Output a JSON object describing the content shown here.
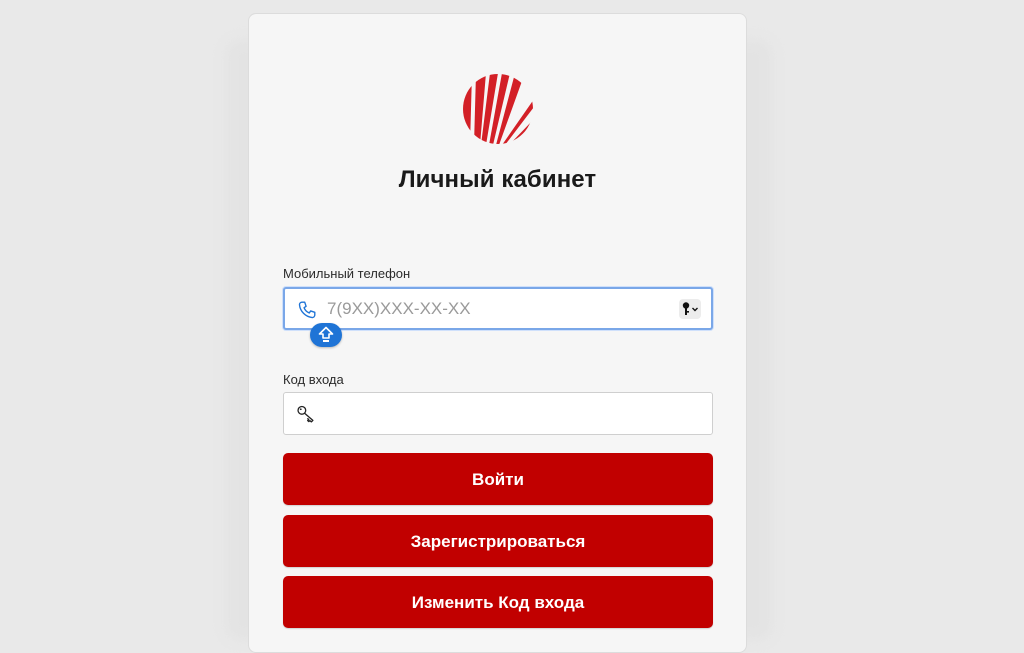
{
  "page": {
    "title": "Личный кабинет"
  },
  "phone": {
    "label": "Мобильный телефон",
    "placeholder": "7(9XX)XXX-XX-XX",
    "value": ""
  },
  "code": {
    "label": "Код входа",
    "value": ""
  },
  "buttons": {
    "login": "Войти",
    "register": "Зарегистрироваться",
    "change_code": "Изменить Код входа"
  },
  "colors": {
    "brand_red": "#c10000",
    "logo_red": "#d32027",
    "focus_blue": "#7aa7e8",
    "caps_badge_blue": "#1f74d6"
  },
  "icons": {
    "logo": "sun-rays-logo",
    "phone": "phone-icon",
    "key": "key-icon",
    "keychain": "keychain-icon",
    "caps_lock": "caps-lock-icon"
  }
}
